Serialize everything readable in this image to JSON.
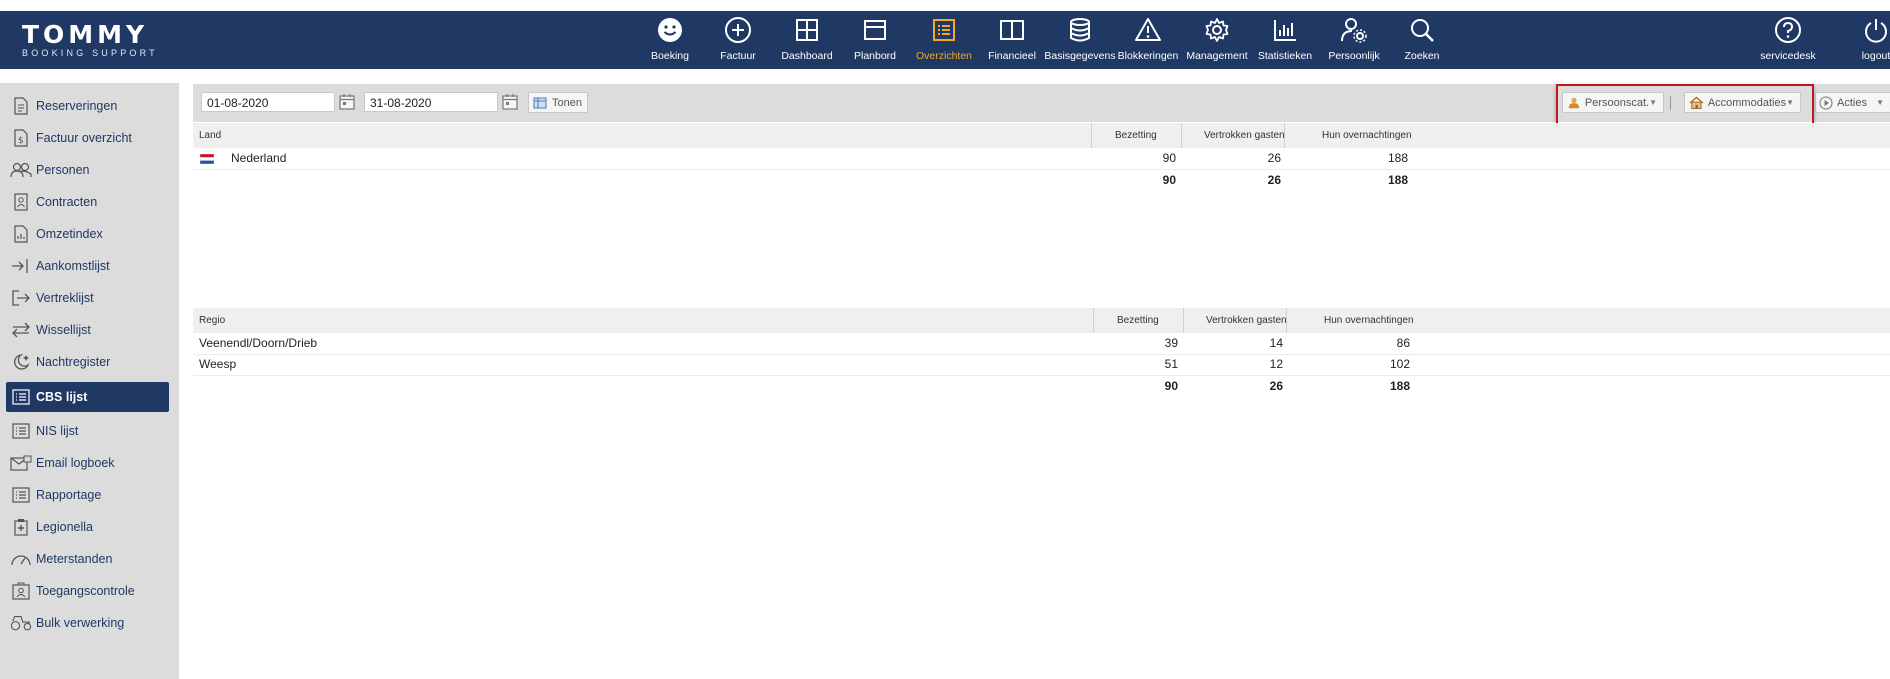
{
  "brand": {
    "name": "TOMMY",
    "tagline": "BOOKING SUPPORT"
  },
  "nav": [
    {
      "label": "Boeking",
      "icon": "smiley-icon"
    },
    {
      "label": "Factuur",
      "icon": "plus-circle-icon"
    },
    {
      "label": "Dashboard",
      "icon": "grid-icon"
    },
    {
      "label": "Planbord",
      "icon": "planbord-icon"
    },
    {
      "label": "Overzichten",
      "icon": "list-icon",
      "active": true
    },
    {
      "label": "Financieel",
      "icon": "columns-icon"
    },
    {
      "label": "Basisgegevens",
      "icon": "database-icon"
    },
    {
      "label": "Blokkeringen",
      "icon": "warning-icon"
    },
    {
      "label": "Management",
      "icon": "gear-icon"
    },
    {
      "label": "Statistieken",
      "icon": "bar-chart-icon"
    },
    {
      "label": "Persoonlijk",
      "icon": "user-gear-icon"
    },
    {
      "label": "Zoeken",
      "icon": "search-icon"
    }
  ],
  "nav_right": [
    {
      "label": "servicedesk",
      "icon": "help-icon"
    },
    {
      "label": "logout",
      "icon": "power-icon"
    }
  ],
  "sidebar": [
    {
      "label": "Reserveringen",
      "icon": "document-icon"
    },
    {
      "label": "Factuur overzicht",
      "icon": "invoice-icon"
    },
    {
      "label": "Personen",
      "icon": "people-icon"
    },
    {
      "label": "Contracten",
      "icon": "contract-icon"
    },
    {
      "label": "Omzetindex",
      "icon": "chart-doc-icon"
    },
    {
      "label": "Aankomstlijst",
      "icon": "arrive-icon"
    },
    {
      "label": "Vertreklijst",
      "icon": "depart-icon"
    },
    {
      "label": "Wissellijst",
      "icon": "swap-icon"
    },
    {
      "label": "Nachtregister",
      "icon": "moon-icon"
    },
    {
      "label": "CBS lijst",
      "icon": "list-icon",
      "active": true
    },
    {
      "label": "NIS lijst",
      "icon": "list-icon"
    },
    {
      "label": "Email logboek",
      "icon": "email-icon"
    },
    {
      "label": "Rapportage",
      "icon": "list-icon"
    },
    {
      "label": "Legionella",
      "icon": "clipboard-plus-icon"
    },
    {
      "label": "Meterstanden",
      "icon": "gauge-icon"
    },
    {
      "label": "Toegangscontrole",
      "icon": "badge-icon"
    },
    {
      "label": "Bulk verwerking",
      "icon": "tractor-icon"
    }
  ],
  "toolbar": {
    "date_from": "01-08-2020",
    "date_to": "31-08-2020",
    "show_label": "Tonen",
    "person_category_label": "Persoonscat.",
    "accommodations_label": "Accommodaties",
    "actions_label": "Acties"
  },
  "country_table": {
    "headers": [
      "Land",
      "Bezetting",
      "Vertrokken gasten",
      "Hun overnachtingen"
    ],
    "rows": [
      {
        "name": "Nederland",
        "bezetting": "90",
        "vertrokken": "26",
        "overnachtingen": "188"
      }
    ],
    "total": {
      "bezetting": "90",
      "vertrokken": "26",
      "overnachtingen": "188"
    }
  },
  "region_table": {
    "headers": [
      "Regio",
      "Bezetting",
      "Vertrokken gasten",
      "Hun overnachtingen"
    ],
    "rows": [
      {
        "name": "Veenendl/Doorn/Drieb",
        "bezetting": "39",
        "vertrokken": "14",
        "overnachtingen": "86"
      },
      {
        "name": "Weesp",
        "bezetting": "51",
        "vertrokken": "12",
        "overnachtingen": "102"
      }
    ],
    "total": {
      "bezetting": "90",
      "vertrokken": "26",
      "overnachtingen": "188"
    }
  },
  "colors": {
    "navy": "#1f3864",
    "active_orange": "#f5a623",
    "highlight_red": "#c0161d"
  }
}
